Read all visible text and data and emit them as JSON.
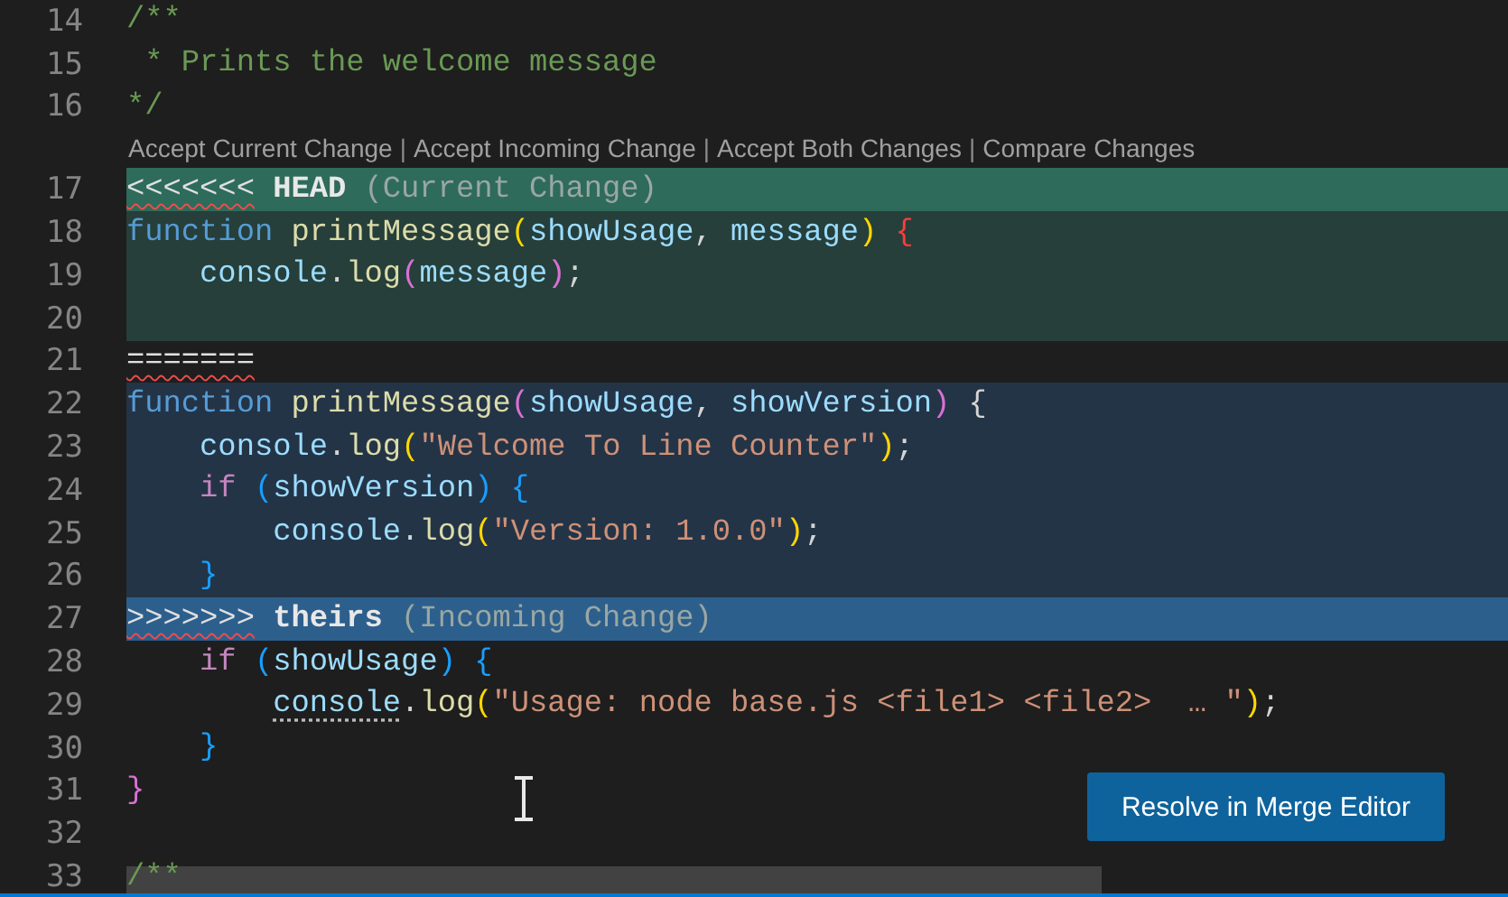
{
  "editor": {
    "lines_before": [
      {
        "number": "14",
        "tokens": [
          {
            "text": "/**",
            "kind": "comment"
          }
        ]
      },
      {
        "number": "15",
        "tokens": [
          {
            "text": " * Prints the welcome message",
            "kind": "comment"
          }
        ]
      },
      {
        "number": "16",
        "tokens": [
          {
            "text": "*/",
            "kind": "comment"
          }
        ]
      }
    ],
    "codelens": [
      {
        "kind": "action",
        "text": "Accept Current Change"
      },
      {
        "kind": "separator",
        "text": "|"
      },
      {
        "kind": "action",
        "text": "Accept Incoming Change"
      },
      {
        "kind": "separator",
        "text": "|"
      },
      {
        "kind": "action",
        "text": "Accept Both Changes"
      },
      {
        "kind": "separator",
        "text": "|"
      },
      {
        "kind": "action",
        "text": "Compare Changes"
      }
    ],
    "lines": [
      {
        "number": "17",
        "kind": "current-marker",
        "tokens": [
          {
            "text": "<<<<<<<",
            "kind": "marker"
          },
          {
            "text": " HEAD",
            "kind": "marker-name"
          },
          {
            "text": " (Current Change)",
            "kind": "dim"
          }
        ]
      },
      {
        "number": "18",
        "kind": "current",
        "tokens": [
          {
            "text": "function",
            "kind": "keyword"
          },
          {
            "text": " printMessage",
            "kind": "function"
          },
          {
            "text": "(",
            "kind": "bracket-gold"
          },
          {
            "text": "showUsage",
            "kind": "param"
          },
          {
            "text": ", ",
            "kind": "punct"
          },
          {
            "text": "message",
            "kind": "param"
          },
          {
            "text": ")",
            "kind": "bracket-gold"
          },
          {
            "text": " {",
            "kind": "bracket-error"
          }
        ]
      },
      {
        "number": "19",
        "kind": "current",
        "tokens": [
          {
            "text": "    console",
            "kind": "param"
          },
          {
            "text": ".",
            "kind": "punct"
          },
          {
            "text": "log",
            "kind": "function"
          },
          {
            "text": "(",
            "kind": "bracket-magenta"
          },
          {
            "text": "message",
            "kind": "param"
          },
          {
            "text": ")",
            "kind": "bracket-magenta"
          },
          {
            "text": ";",
            "kind": "punct"
          }
        ]
      },
      {
        "number": "20",
        "kind": "current"
      },
      {
        "number": "21",
        "kind": "separator",
        "tokens": [
          {
            "text": "=======",
            "kind": "marker"
          }
        ]
      },
      {
        "number": "22",
        "kind": "incoming",
        "tokens": [
          {
            "text": "function",
            "kind": "keyword"
          },
          {
            "text": " printMessage",
            "kind": "function"
          },
          {
            "text": "(",
            "kind": "bracket-magenta"
          },
          {
            "text": "showUsage",
            "kind": "param"
          },
          {
            "text": ", ",
            "kind": "punct"
          },
          {
            "text": "showVersion",
            "kind": "param"
          },
          {
            "text": ")",
            "kind": "bracket-magenta"
          },
          {
            "text": " {",
            "kind": "punct"
          }
        ]
      },
      {
        "number": "23",
        "kind": "incoming",
        "tokens": [
          {
            "text": "    console",
            "kind": "param"
          },
          {
            "text": ".",
            "kind": "punct"
          },
          {
            "text": "log",
            "kind": "function"
          },
          {
            "text": "(",
            "kind": "bracket-gold"
          },
          {
            "text": "\"Welcome To Line Counter\"",
            "kind": "string"
          },
          {
            "text": ")",
            "kind": "bracket-gold"
          },
          {
            "text": ";",
            "kind": "punct"
          }
        ]
      },
      {
        "number": "24",
        "kind": "incoming",
        "tokens": [
          {
            "text": "    if",
            "kind": "control"
          },
          {
            "text": " (",
            "kind": "bracket-blue"
          },
          {
            "text": "showVersion",
            "kind": "param"
          },
          {
            "text": ") {",
            "kind": "bracket-blue"
          }
        ]
      },
      {
        "number": "25",
        "kind": "incoming",
        "tokens": [
          {
            "text": "        console",
            "kind": "param"
          },
          {
            "text": ".",
            "kind": "punct"
          },
          {
            "text": "log",
            "kind": "function"
          },
          {
            "text": "(",
            "kind": "bracket-gold"
          },
          {
            "text": "\"Version: 1.0.0\"",
            "kind": "string"
          },
          {
            "text": ")",
            "kind": "bracket-gold"
          },
          {
            "text": ";",
            "kind": "punct"
          }
        ]
      },
      {
        "number": "26",
        "kind": "incoming",
        "tokens": [
          {
            "text": "    }",
            "kind": "bracket-blue"
          }
        ]
      },
      {
        "number": "27",
        "kind": "incoming-marker",
        "tokens": [
          {
            "text": ">>>>>>>",
            "kind": "marker"
          },
          {
            "text": " theirs",
            "kind": "marker-name"
          },
          {
            "text": " (Incoming Change)",
            "kind": "dim"
          }
        ]
      },
      {
        "number": "28",
        "kind": "normal",
        "tokens": [
          {
            "text": "    if",
            "kind": "control"
          },
          {
            "text": " (",
            "kind": "bracket-blue"
          },
          {
            "text": "showUsage",
            "kind": "param"
          },
          {
            "text": ") {",
            "kind": "bracket-blue"
          }
        ]
      },
      {
        "number": "29",
        "kind": "normal",
        "tokens": [
          {
            "text": "        console",
            "kind": "param-hint"
          },
          {
            "text": ".",
            "kind": "punct"
          },
          {
            "text": "log",
            "kind": "function"
          },
          {
            "text": "(",
            "kind": "bracket-gold"
          },
          {
            "text": "\"Usage: node base.js <file1> <file2>  … \"",
            "kind": "string"
          },
          {
            "text": ")",
            "kind": "bracket-gold"
          },
          {
            "text": ";",
            "kind": "punct"
          }
        ]
      },
      {
        "number": "30",
        "kind": "normal",
        "tokens": [
          {
            "text": "    }",
            "kind": "bracket-blue"
          }
        ]
      },
      {
        "number": "31",
        "kind": "normal",
        "tokens": [
          {
            "text": "}",
            "kind": "bracket-magenta"
          }
        ]
      },
      {
        "number": "32",
        "kind": "normal"
      },
      {
        "number": "33",
        "kind": "normal",
        "tokens": [
          {
            "text": "/**",
            "kind": "comment"
          }
        ]
      }
    ]
  },
  "merge_button": {
    "label": "Resolve in Merge Editor"
  }
}
